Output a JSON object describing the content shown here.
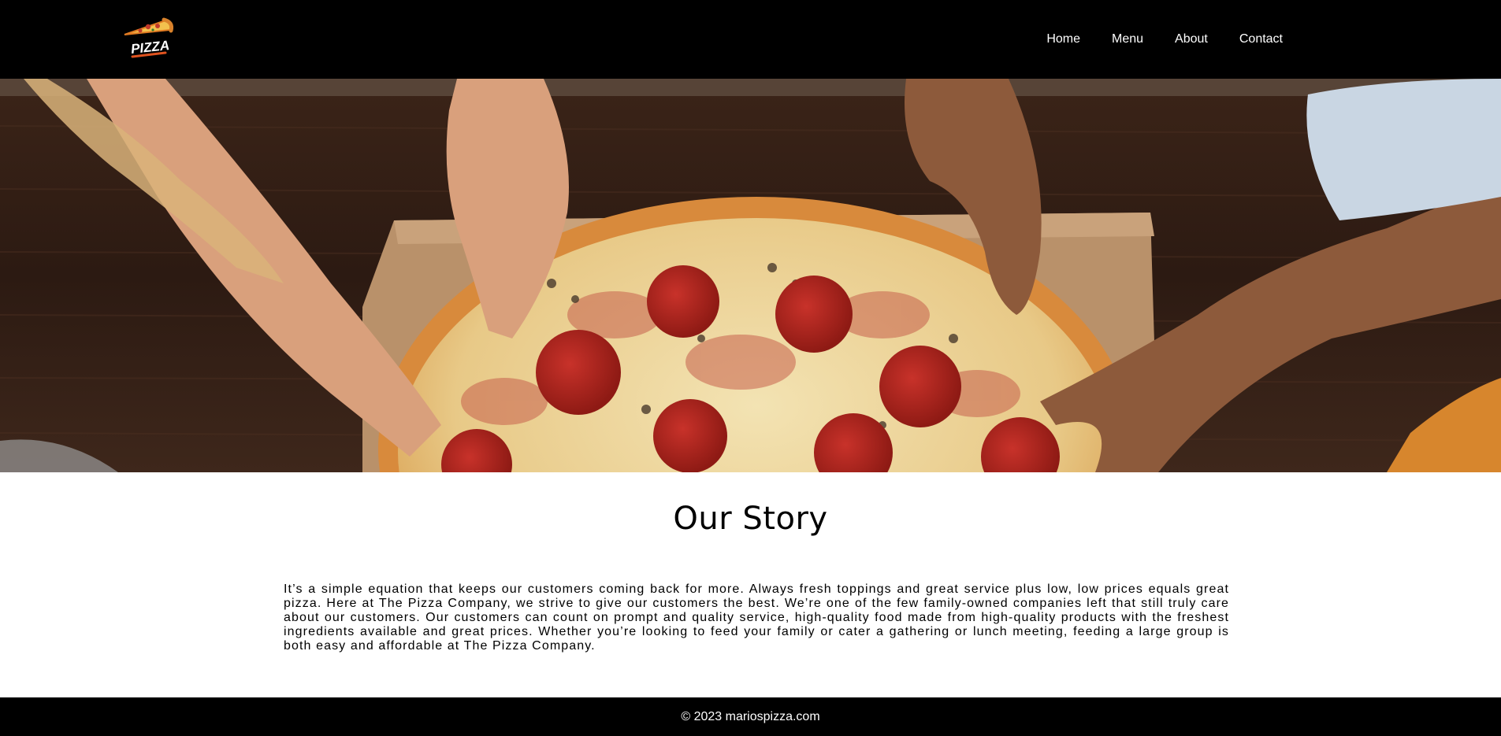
{
  "header": {
    "logo_text": "PIZZA",
    "nav": [
      {
        "label": "Home"
      },
      {
        "label": "Menu"
      },
      {
        "label": "About"
      },
      {
        "label": "Contact"
      }
    ]
  },
  "hero": {
    "image": "pizza-sharing-photo"
  },
  "story": {
    "title": "Our Story",
    "body": "It’s a simple equation that keeps our customers coming back for more. Always fresh toppings and great service plus low, low prices equals great pizza. Here at The Pizza Company, we strive to give our customers the best. We’re one of the few family-owned companies left that still truly care about our customers. Our customers can count on prompt and quality service, high-quality food made from high-quality products with the freshest ingredients available and great prices. Whether you’re looking to feed your family or cater a gathering or lunch meeting, feeding a large group is both easy and affordable at The Pizza Company."
  },
  "footer": {
    "copyright": "© 2023 mariospizza.com"
  },
  "colors": {
    "header_bg": "#000000",
    "footer_bg": "#000000",
    "nav_text": "#ffffff",
    "pepperoni": "#b3201a",
    "crust": "#e3a04a"
  }
}
